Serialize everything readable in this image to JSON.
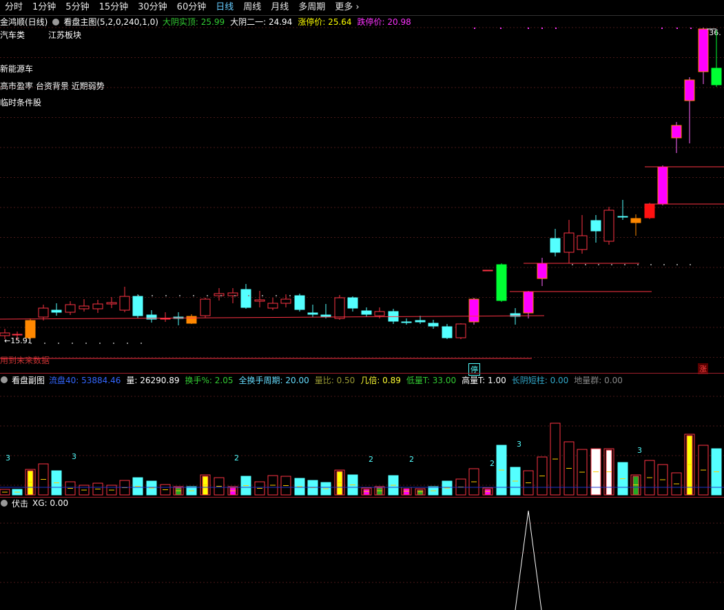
{
  "toolbar": {
    "periods": [
      "分时",
      "1分钟",
      "5分钟",
      "15分钟",
      "30分钟",
      "60分钟",
      "日线",
      "周线",
      "月线",
      "多周期",
      "更多"
    ],
    "active": "日线",
    "more_arrow": "›"
  },
  "main": {
    "stock_name": "金鸿顺(日线)",
    "indicator_name": "看盘主图(5,2,0,240,1,0)",
    "items": [
      {
        "label": "大阴实顶: 25.99",
        "color": "#33cc33"
      },
      {
        "label": "大阴二一: 24.94",
        "color": "#ffffff"
      },
      {
        "label": "涨停价: 25.64",
        "color": "#ffff00"
      },
      {
        "label": "跌停价: 20.98",
        "color": "#ff33ff"
      }
    ],
    "sector": "汽车类",
    "board": "江苏板块",
    "concept": "新能源车",
    "notes": "高市盈率 台资背景 近期弱势",
    "temp": "临时条件股",
    "future_warning": "用到未来数据",
    "high_label": "36.",
    "low_label": "15.91",
    "stop_tag": "停",
    "up_tag": "涨"
  },
  "sub": {
    "title": "看盘副图",
    "items": [
      {
        "label": "流盘40: 53884.46",
        "color": "#3366ff"
      },
      {
        "label": "量: 26290.89",
        "color": "#ffffff"
      },
      {
        "label": "换手%: 2.05",
        "color": "#33cc33"
      },
      {
        "label": "全换手周期: 20.00",
        "color": "#66ddff"
      },
      {
        "label": "量比: 0.50",
        "color": "#999933"
      },
      {
        "label": "几倍: 0.89",
        "color": "#ffff33"
      },
      {
        "label": "低量T: 33.00",
        "color": "#33cc33"
      },
      {
        "label": "高量T: 1.00",
        "color": "#ffffff"
      },
      {
        "label": "长阴短柱: 0.00",
        "color": "#33aacc"
      },
      {
        "label": "地量群: 0.00",
        "color": "#888888"
      }
    ],
    "vol_marks": [
      "3",
      "3",
      "2",
      "2",
      "2",
      "2",
      "3",
      "3"
    ]
  },
  "fuji": {
    "title": "伏击",
    "value": "XG: 0.00"
  },
  "colors": {
    "up": "#ff3344",
    "down": "#54ffff",
    "grid": "#5a1a1a",
    "magenta": "#ff00ff",
    "green": "#00ff33",
    "orange": "#ff8800"
  }
}
